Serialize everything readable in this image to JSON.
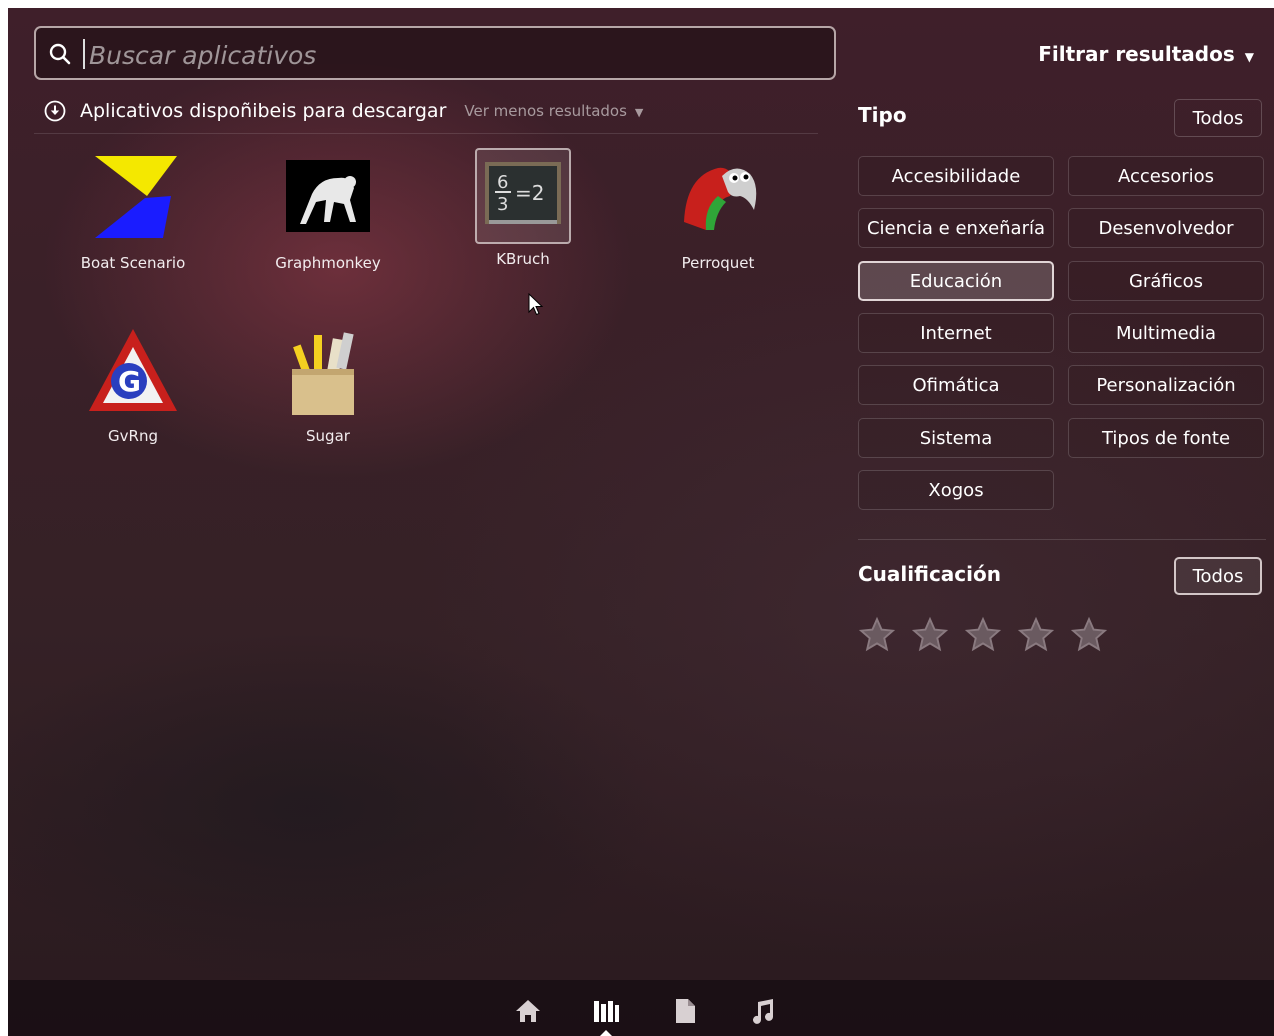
{
  "search": {
    "placeholder": "Buscar aplicativos",
    "value": ""
  },
  "section": {
    "title": "Aplicativos dispoñibeis para descargar",
    "toggle_label": "Ver menos resultados"
  },
  "apps": [
    {
      "label": "Boat Scenario",
      "icon": "boat-scenario-icon"
    },
    {
      "label": "Graphmonkey",
      "icon": "graphmonkey-icon"
    },
    {
      "label": "KBruch",
      "icon": "kbruch-icon",
      "selected": true
    },
    {
      "label": "Perroquet",
      "icon": "perroquet-icon"
    },
    {
      "label": "GvRng",
      "icon": "gvrng-icon"
    },
    {
      "label": "Sugar",
      "icon": "sugar-icon"
    }
  ],
  "filters": {
    "title": "Filtrar resultados",
    "type": {
      "label": "Tipo",
      "all_label": "Todos",
      "categories": [
        "Accesibilidade",
        "Accesorios",
        "Ciencia e enxeñaría",
        "Desenvolvedor",
        "Educación",
        "Gráficos",
        "Internet",
        "Multimedia",
        "Ofimática",
        "Personalización",
        "Sistema",
        "Tipos de fonte",
        "Xogos"
      ],
      "active": "Educación"
    },
    "rating": {
      "label": "Cualificación",
      "all_label": "Todos",
      "stars_max": 5,
      "stars_selected": 0
    }
  },
  "launcher": {
    "lenses": [
      "home-icon",
      "applications-icon",
      "files-icon",
      "music-icon"
    ],
    "active": "applications-icon"
  },
  "colors": {
    "background": "#3a2028",
    "chip_border": "#ffffff29",
    "text": "#ffffff"
  }
}
